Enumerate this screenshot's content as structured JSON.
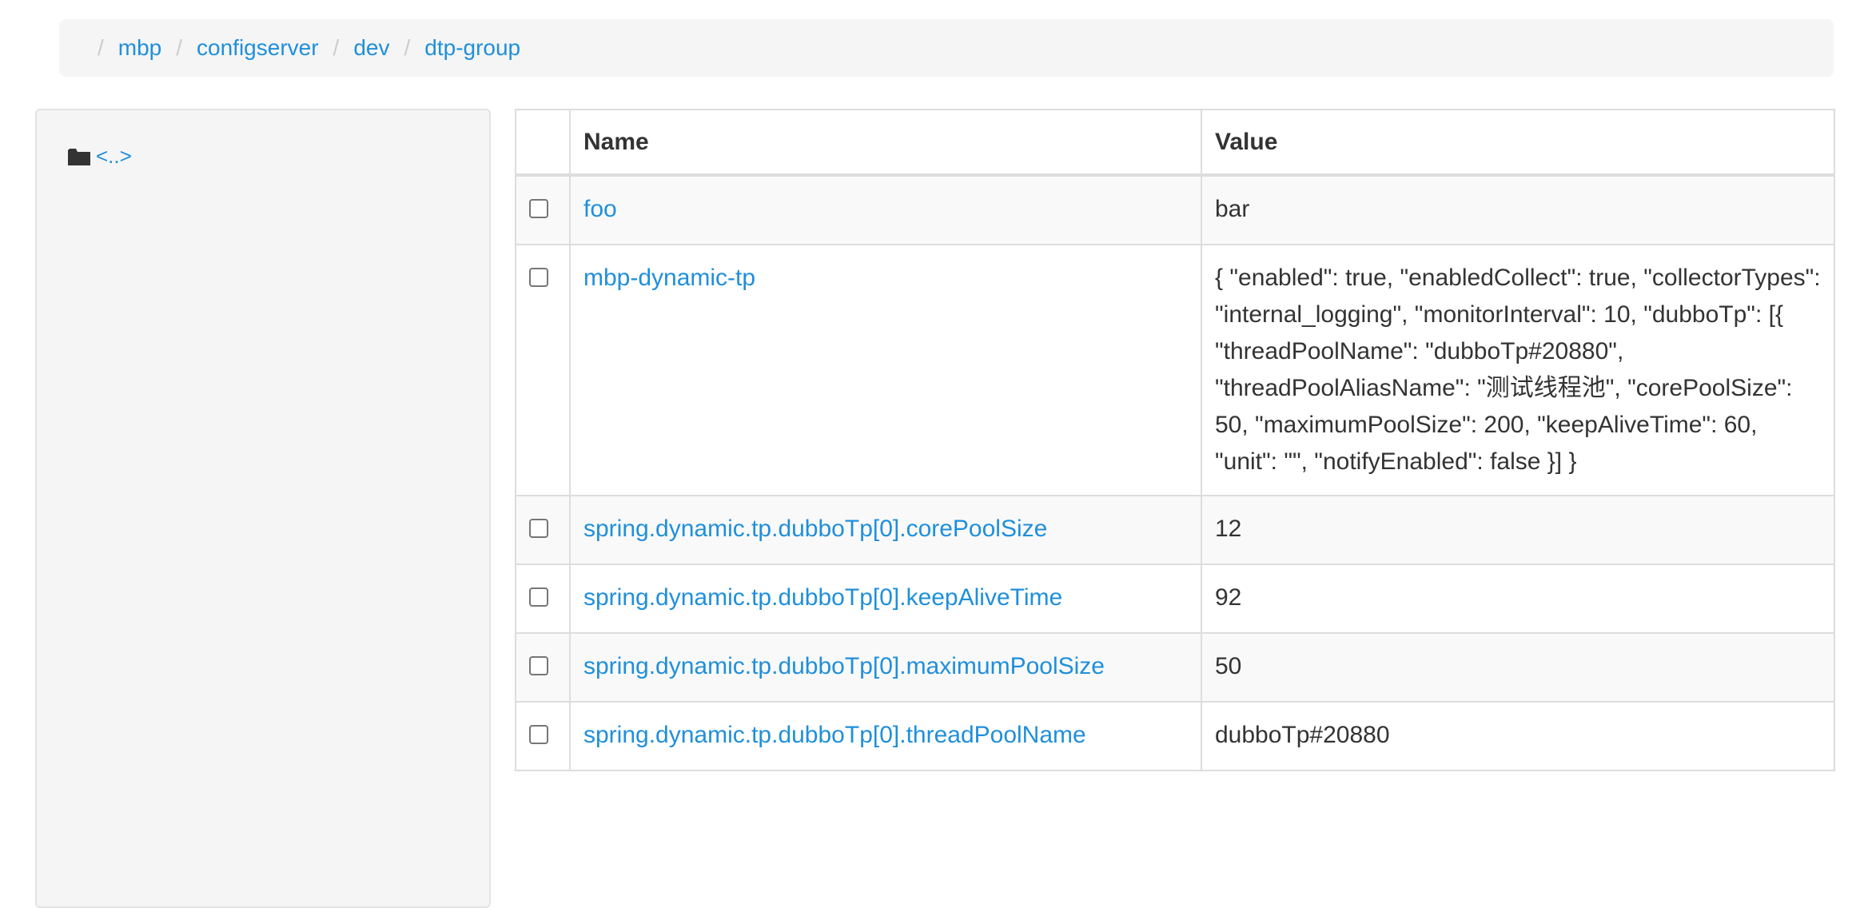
{
  "breadcrumb": {
    "separator": "/",
    "items": [
      "mbp",
      "configserver",
      "dev",
      "dtp-group"
    ]
  },
  "sidebar": {
    "parent_link": "<..>",
    "icon": "folder-icon"
  },
  "table": {
    "headers": {
      "name": "Name",
      "value": "Value"
    },
    "rows": [
      {
        "name": "foo",
        "value": "bar"
      },
      {
        "name": "mbp-dynamic-tp",
        "value": "{ \"enabled\": true, \"enabledCollect\": true, \"collectorTypes\": \"internal_logging\", \"monitorInterval\": 10, \"dubboTp\": [{ \"threadPoolName\": \"dubboTp#20880\", \"threadPoolAliasName\": \"测试线程池\", \"corePoolSize\": 50, \"maximumPoolSize\": 200, \"keepAliveTime\": 60, \"unit\": \"\", \"notifyEnabled\": false }] }"
      },
      {
        "name": "spring.dynamic.tp.dubboTp[0].corePoolSize",
        "value": "12"
      },
      {
        "name": "spring.dynamic.tp.dubboTp[0].keepAliveTime",
        "value": "92"
      },
      {
        "name": "spring.dynamic.tp.dubboTp[0].maximumPoolSize",
        "value": "50"
      },
      {
        "name": "spring.dynamic.tp.dubboTp[0].threadPoolName",
        "value": "dubboTp#20880"
      }
    ]
  },
  "colors": {
    "link": "#1f8fdb",
    "text": "#333333",
    "breadcrumb_bg": "#f5f5f5",
    "border": "#dddddd"
  }
}
